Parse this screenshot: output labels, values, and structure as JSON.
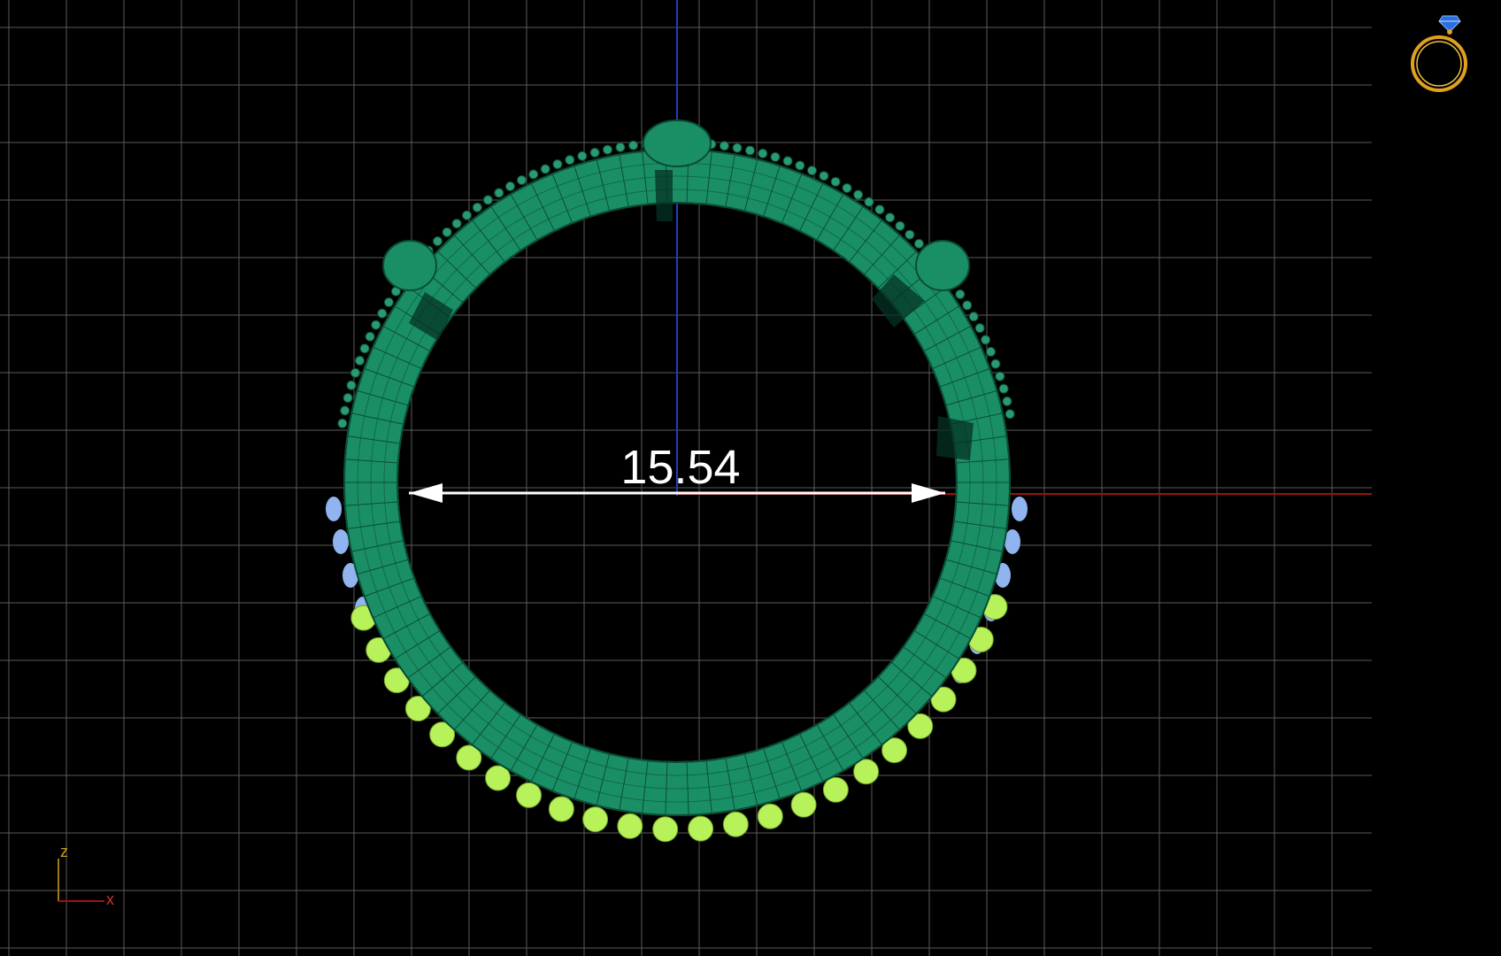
{
  "viewport": {
    "view": "front",
    "colors": {
      "background": "#000000",
      "grid": "#5a5a5a",
      "axis_z": "#1e3fbf",
      "axis_x": "#a01010",
      "ring_fill": "#1a8f66",
      "ring_wire": "#0a4d35",
      "stone_yellow": "#b8f25a",
      "stone_blue": "#8fb4ef",
      "dimension": "#ffffff"
    }
  },
  "dimension": {
    "value": "15.54"
  },
  "axis_gizmo": {
    "z_label": "z",
    "x_label": "x"
  },
  "view_icon": {
    "icon": "ring-icon"
  }
}
